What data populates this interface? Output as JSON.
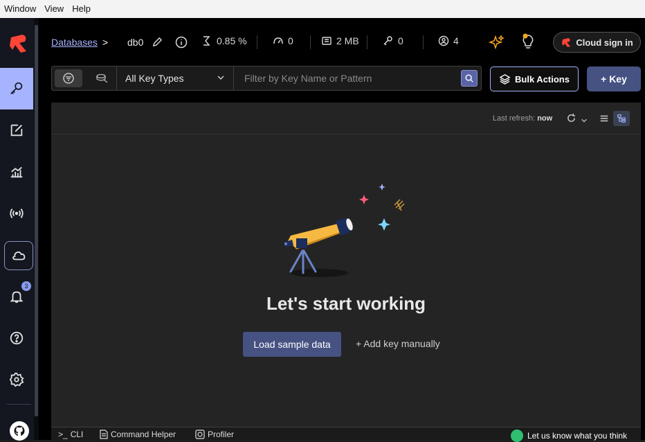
{
  "menubar": {
    "items": [
      "Window",
      "View",
      "Help"
    ]
  },
  "sidebar": {
    "items": [
      {
        "name": "browser",
        "icon": "key-icon",
        "active": true
      },
      {
        "name": "workbench",
        "icon": "edit-icon"
      },
      {
        "name": "analytics",
        "icon": "chart-icon"
      },
      {
        "name": "pubsub",
        "icon": "broadcast-icon"
      },
      {
        "name": "cloud",
        "icon": "cloud-icon"
      },
      {
        "name": "notifications",
        "icon": "bell-icon",
        "badge": "3"
      },
      {
        "name": "help",
        "icon": "help-icon"
      },
      {
        "name": "settings",
        "icon": "gear-icon"
      }
    ]
  },
  "topbar": {
    "breadcrumb": "Databases",
    "breadcrumb_sep": ">",
    "db_name": "db0",
    "cpu": "0.85 %",
    "ops": "0",
    "memory": "2 MB",
    "keys": "0",
    "clients": "4",
    "cloud_signin": "Cloud sign in"
  },
  "filter": {
    "key_type": "All Key Types",
    "search_placeholder": "Filter by Key Name or Pattern",
    "bulk_actions": "Bulk Actions",
    "add_key": "+ Key"
  },
  "panel": {
    "last_refresh_label": "Last refresh:",
    "last_refresh_value": "now",
    "empty_title": "Let's start working",
    "load_sample": "Load sample data",
    "add_manually": "+ Add key manually"
  },
  "bottombar": {
    "cli": "CLI",
    "cli_prefix": ">_",
    "command_helper": "Command Helper",
    "profiler": "Profiler",
    "feedback": "Let us know what you think"
  },
  "colors": {
    "accent": "#a6b4ff",
    "primary_button": "#465282",
    "brand_red": "#ff4438"
  }
}
